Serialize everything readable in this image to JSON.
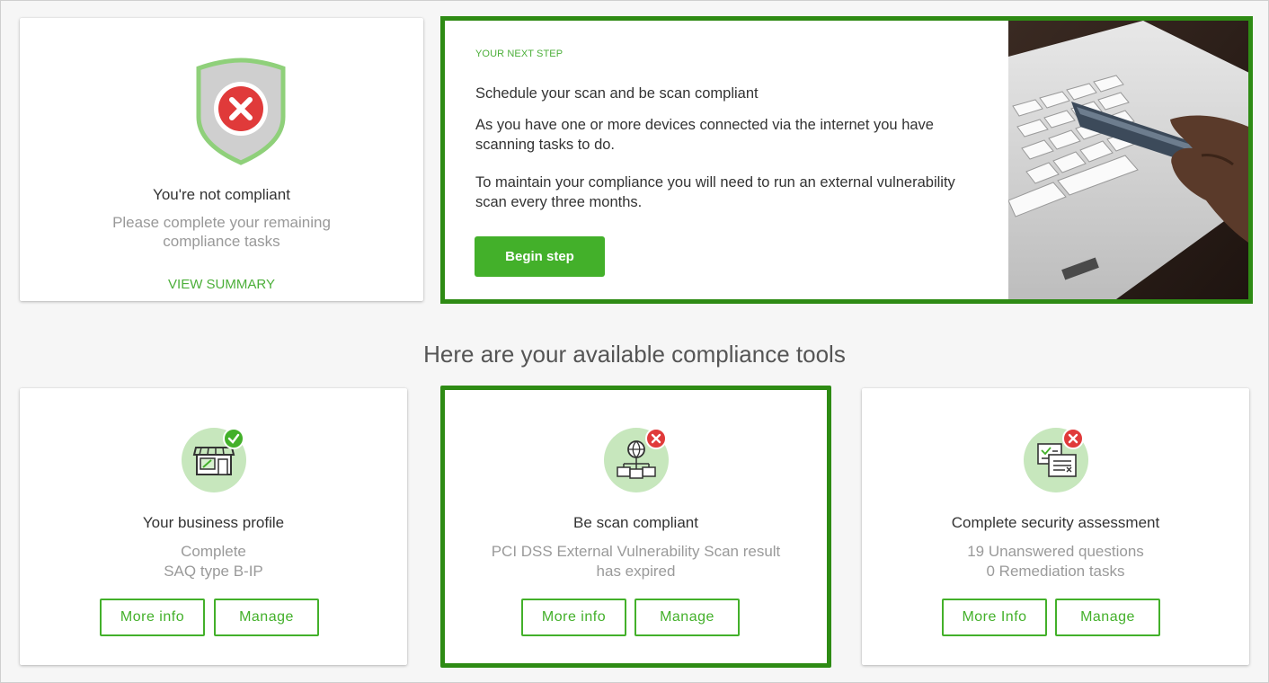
{
  "status": {
    "title": "You're not compliant",
    "description_line1": "Please complete your remaining",
    "description_line2": "compliance tasks",
    "link": "VIEW SUMMARY",
    "icon": "shield-x-icon"
  },
  "next_step": {
    "eyebrow": "YOUR NEXT STEP",
    "headline": "Schedule your scan and be scan compliant",
    "para1": "As you have one or more devices connected via the internet you have scanning tasks to do.",
    "para2": "To maintain your compliance you will need to run an external vulnerability scan every three months.",
    "button": "Begin step"
  },
  "tools_heading": "Here are your available compliance tools",
  "tools": [
    {
      "title": "Your business profile",
      "line1": "Complete",
      "line2": "SAQ type B-IP",
      "more": "More info",
      "manage": "Manage",
      "icon": "storefront-icon",
      "status": "complete"
    },
    {
      "title": "Be scan compliant",
      "line1": "PCI DSS External Vulnerability Scan result",
      "line2": "has expired",
      "more": "More info",
      "manage": "Manage",
      "icon": "network-globe-icon",
      "status": "incomplete"
    },
    {
      "title": "Complete security assessment",
      "line1": "19 Unanswered questions",
      "line2": "0 Remediation tasks",
      "more": "More Info",
      "manage": "Manage",
      "icon": "checklist-document-icon",
      "status": "incomplete"
    }
  ],
  "colors": {
    "brand_green": "#43b02a",
    "highlight_green": "#2e8b14",
    "error_red": "#e03a3a"
  }
}
